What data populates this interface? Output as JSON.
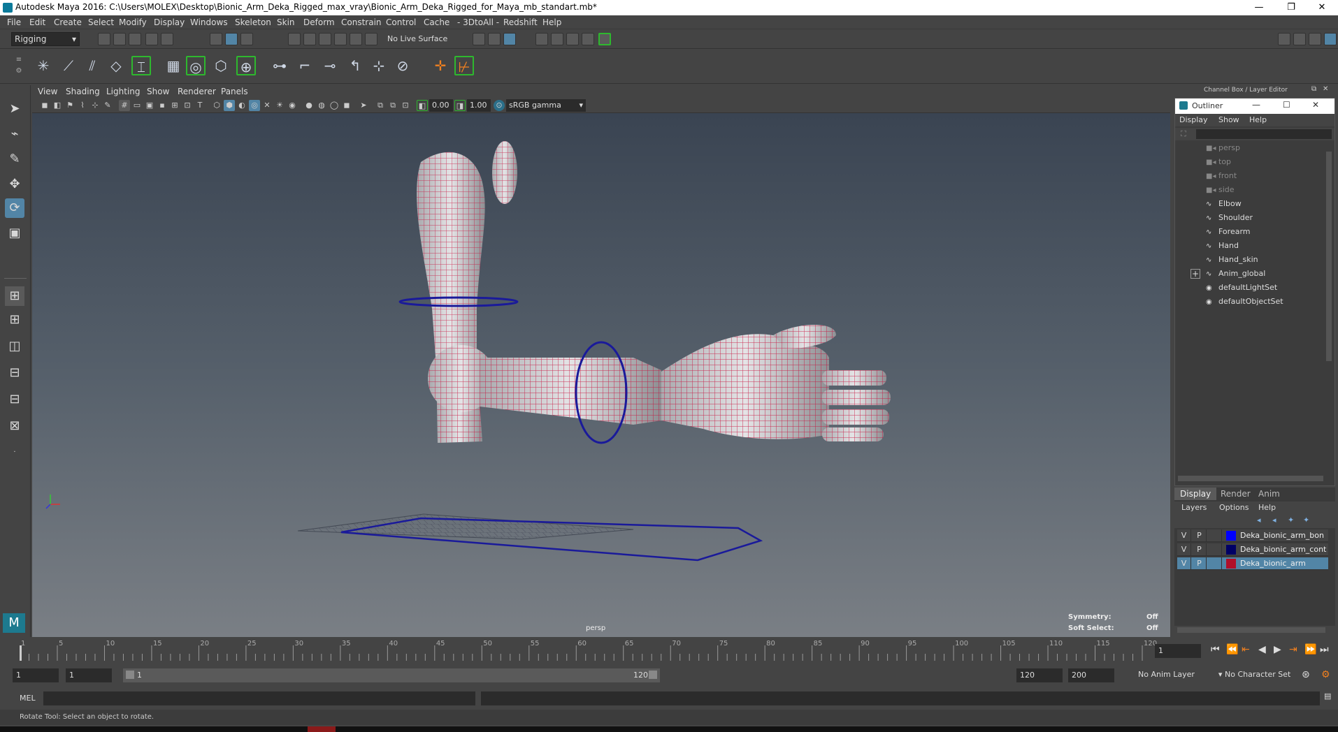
{
  "window": {
    "title": "Autodesk Maya 2016: C:\\Users\\MOLEX\\Desktop\\Bionic_Arm_Deka_Rigged_max_vray\\Bionic_Arm_Deka_Rigged_for_Maya_mb_standart.mb*",
    "minimize": "—",
    "restore": "❐",
    "close": "✕"
  },
  "menubar": [
    "File",
    "Edit",
    "Create",
    "Select",
    "Modify",
    "Display",
    "Windows",
    "Skeleton",
    "Skin",
    "Deform",
    "Constrain",
    "Control",
    "Cache",
    "- 3DtoAll -",
    "Redshift",
    "Help"
  ],
  "statusline": {
    "mode": "Rigging",
    "live_surface": "No Live Surface"
  },
  "viewport": {
    "menu": [
      "View",
      "Shading",
      "Lighting",
      "Show",
      "Renderer",
      "Panels"
    ],
    "exposure": "0.00",
    "gamma": "1.00",
    "color_space": "sRGB gamma",
    "camera_label": "persp",
    "symmetry_label": "Symmetry:",
    "symmetry_value": "Off",
    "soft_select_label": "Soft Select:",
    "soft_select_value": "Off"
  },
  "channelbox": {
    "title": "Channel Box / Layer Editor"
  },
  "outliner": {
    "title": "Outliner",
    "menu": [
      "Display",
      "Show",
      "Help"
    ],
    "items": [
      {
        "name": "persp",
        "dim": true,
        "icon": "camera-icon"
      },
      {
        "name": "top",
        "dim": true,
        "icon": "camera-icon"
      },
      {
        "name": "front",
        "dim": true,
        "icon": "camera-icon"
      },
      {
        "name": "side",
        "dim": true,
        "icon": "camera-icon"
      },
      {
        "name": "Elbow",
        "dim": false,
        "icon": "curve-icon"
      },
      {
        "name": "Shoulder",
        "dim": false,
        "icon": "curve-icon"
      },
      {
        "name": "Forearm",
        "dim": false,
        "icon": "curve-icon"
      },
      {
        "name": "Hand",
        "dim": false,
        "icon": "curve-icon"
      },
      {
        "name": "Hand_skin",
        "dim": false,
        "icon": "curve-icon"
      },
      {
        "name": "Anim_global",
        "dim": false,
        "icon": "curve-icon",
        "expand": "+"
      },
      {
        "name": "defaultLightSet",
        "dim": false,
        "icon": "set-icon"
      },
      {
        "name": "defaultObjectSet",
        "dim": false,
        "icon": "set-icon"
      }
    ]
  },
  "layer_editor": {
    "tabs": [
      "Display",
      "Render",
      "Anim"
    ],
    "menu": [
      "Layers",
      "Options",
      "Help"
    ],
    "layers": [
      {
        "v": "V",
        "p": "P",
        "color": "#0000ff",
        "name": "Deka_bionic_arm_bon",
        "selected": false
      },
      {
        "v": "V",
        "p": "P",
        "color": "#000066",
        "name": "Deka_bionic_arm_cont",
        "selected": false
      },
      {
        "v": "V",
        "p": "P",
        "color": "#b0102a",
        "name": "Deka_bionic_arm",
        "selected": true
      }
    ]
  },
  "timeline": {
    "ticks": [
      "1",
      "5",
      "10",
      "15",
      "20",
      "25",
      "30",
      "35",
      "40",
      "45",
      "50",
      "55",
      "60",
      "65",
      "70",
      "75",
      "80",
      "85",
      "90",
      "95",
      "100",
      "105",
      "110",
      "115",
      "120"
    ],
    "current_frame": "1"
  },
  "range": {
    "start": "1",
    "playback_start": "1",
    "slider_start": "1",
    "slider_end": "120",
    "playback_end": "120",
    "end": "200",
    "anim_layer": "No Anim Layer",
    "character_set": "No Character Set"
  },
  "cmdline": {
    "lang": "MEL"
  },
  "helpline": {
    "text": "Rotate Tool: Select an object to rotate."
  },
  "colors": {
    "accent": "#5285a6",
    "mesh_wire": "#c8103c",
    "control_wire": "#1a1a9a"
  }
}
